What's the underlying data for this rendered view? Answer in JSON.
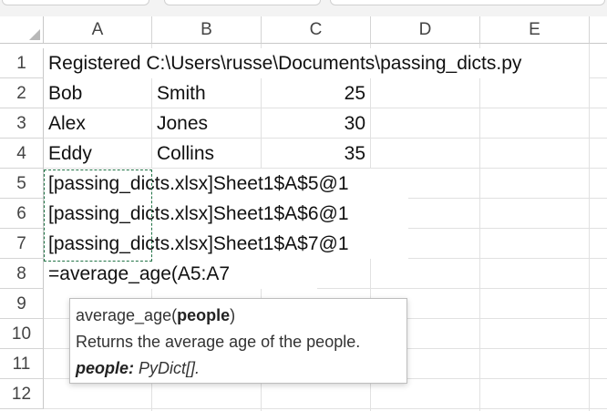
{
  "columns": [
    "A",
    "B",
    "C",
    "D",
    "E"
  ],
  "rows": [
    "1",
    "2",
    "3",
    "4",
    "5",
    "6",
    "7",
    "8",
    "9",
    "10",
    "11",
    "12"
  ],
  "cells": {
    "a1": "Registered C:\\Users\\russe\\Documents\\passing_dicts.py",
    "a2": "Bob",
    "b2": "Smith",
    "c2": "25",
    "a3": "Alex",
    "b3": "Jones",
    "c3": "30",
    "a4": "Eddy",
    "b4": "Collins",
    "c4": "35",
    "a5": "[passing_dicts.xlsx]Sheet1$A$5@1",
    "a6": "[passing_dicts.xlsx]Sheet1$A$6@1",
    "a7": "[passing_dicts.xlsx]Sheet1$A$7@1",
    "a8": "=average_age(A5:A7"
  },
  "tooltip": {
    "func_name": "average_age(",
    "param": "people",
    "close": ")",
    "description": "Returns the average age of the people.",
    "param_label": "people:",
    "param_type": " PyDict[]."
  },
  "colors": {
    "selection_border": "#217346",
    "header_text": "#444444",
    "grid": "#e1e1e1"
  }
}
